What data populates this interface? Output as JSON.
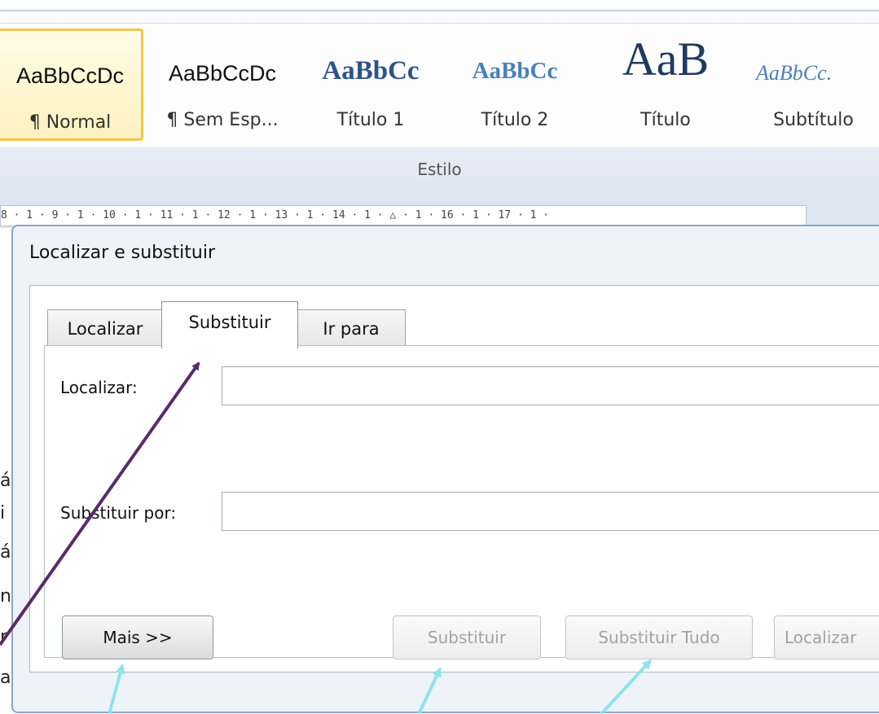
{
  "ribbon": {
    "styles": [
      {
        "sample": "AaBbCcDc",
        "label": "¶ Normal"
      },
      {
        "sample": "AaBbCcDc",
        "label": "¶ Sem Esp..."
      },
      {
        "sample": "AaBbCc",
        "label": "Título 1"
      },
      {
        "sample": "AaBbCc",
        "label": "Título 2"
      },
      {
        "sample": "AaB",
        "label": "Título"
      },
      {
        "sample": "AaBbCc.",
        "label": "Subtítulo"
      }
    ],
    "group_label": "Estilo"
  },
  "ruler": {
    "text": "8 · 1 · 9 · 1 · 10 · 1 · 11 · 1 · 12 · 1 · 13 · 1 · 14 · 1 · △ · 1 · 16 · 1 · 17 · 1 ·"
  },
  "dialog": {
    "title": "Localizar e substituir",
    "tabs": [
      "Localizar",
      "Substituir",
      "Ir para"
    ],
    "find_label": "Localizar:",
    "find_value": "",
    "replace_label": "Substituir por:",
    "replace_value": "",
    "buttons": {
      "more": "Mais >>",
      "replace": "Substituir",
      "replace_all": "Substituir Tudo",
      "find_next": "Localizar"
    }
  },
  "edge_glyphs": [
    "á",
    "i",
    "á",
    "n",
    "r",
    "a"
  ],
  "colors": {
    "tab_arrow": "#5a2a6b",
    "button_arrows": "#8fe3ea",
    "selected_style_border": "#f2c54d"
  }
}
